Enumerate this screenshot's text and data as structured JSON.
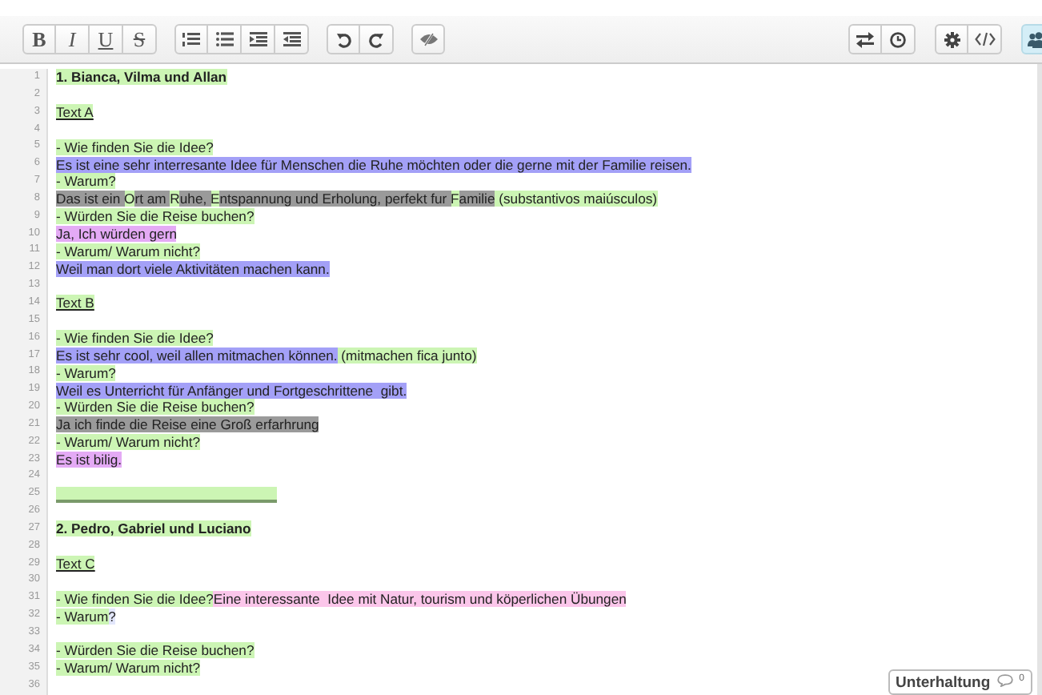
{
  "toolbar": {
    "left_groups": [
      [
        {
          "kind": "letter",
          "label": "B",
          "on": false
        },
        {
          "kind": "letter",
          "label": "I",
          "on": false
        },
        {
          "kind": "letter",
          "label": "U",
          "on": false
        },
        {
          "kind": "letter",
          "label": "S",
          "on": false
        }
      ],
      [
        {
          "kind": "ordered-list",
          "on": false
        },
        {
          "kind": "bullet-list",
          "on": false
        },
        {
          "kind": "indent",
          "on": false
        },
        {
          "kind": "outdent",
          "on": false
        }
      ],
      [
        {
          "kind": "undo",
          "on": false
        },
        {
          "kind": "redo",
          "on": false
        }
      ],
      [
        {
          "kind": "clear-authorship",
          "on": false
        }
      ]
    ],
    "right_groups": [
      [
        {
          "kind": "import-export",
          "on": false
        },
        {
          "kind": "history",
          "on": false
        }
      ],
      [
        {
          "kind": "settings",
          "on": false
        },
        {
          "kind": "embed",
          "on": false
        }
      ],
      [
        {
          "kind": "users",
          "on": true
        }
      ]
    ]
  },
  "lines": [
    {
      "number": "1",
      "kind": "heading",
      "segments": [
        {
          "text": "1. Bianca, Vilma und Allan",
          "color": "#ccf5b4"
        }
      ]
    },
    {
      "number": "2"
    },
    {
      "number": "3",
      "kind": "label",
      "segments": [
        {
          "text": "Text A",
          "color": "#ccf5b4"
        }
      ]
    },
    {
      "number": "4"
    },
    {
      "number": "5",
      "segments": [
        {
          "text": "- Wie finden Sie die Idee?",
          "color": "#ccf5b4"
        }
      ]
    },
    {
      "number": "6",
      "segments": [
        {
          "text": "Es ist eine sehr interresante Idee für Menschen die Ruhe möchten oder die gerne mit der Familie reisen.",
          "color": "#a3a0f7"
        }
      ]
    },
    {
      "number": "7",
      "segments": [
        {
          "text": "- Warum?",
          "color": "#ccf5b4"
        }
      ]
    },
    {
      "number": "8",
      "segments": [
        {
          "text": "Das ist ein ",
          "color": "#9a9a9a"
        },
        {
          "text": "O",
          "color": "#ccf5b4"
        },
        {
          "text": "rt am ",
          "color": "#9a9a9a"
        },
        {
          "text": "R",
          "color": "#ccf5b4"
        },
        {
          "text": "uhe, ",
          "color": "#9a9a9a"
        },
        {
          "text": "E",
          "color": "#ccf5b4"
        },
        {
          "text": "ntspannung und Erholung, perfekt fur ",
          "color": "#9a9a9a"
        },
        {
          "text": "F",
          "color": "#ccf5b4"
        },
        {
          "text": "amilie",
          "color": "#9a9a9a"
        },
        {
          "text": " (substantivos maiúsculos)",
          "color": "#ccf5b4"
        }
      ]
    },
    {
      "number": "9",
      "segments": [
        {
          "text": "- Würden Sie die Reise buchen?",
          "color": "#ccf5b4"
        }
      ]
    },
    {
      "number": "10",
      "segments": [
        {
          "text": "Ja, Ich würden gern",
          "color": "#e4aaf5"
        }
      ]
    },
    {
      "number": "11",
      "segments": [
        {
          "text": "- Warum/ Warum nicht?",
          "color": "#ccf5b4"
        }
      ]
    },
    {
      "number": "12",
      "segments": [
        {
          "text": "Weil man dort viele Aktivitäten machen kann.",
          "color": "#a3a0f7"
        }
      ]
    },
    {
      "number": "13"
    },
    {
      "number": "14",
      "kind": "label",
      "segments": [
        {
          "text": "Text B",
          "color": "#ccf5b4"
        }
      ]
    },
    {
      "number": "15"
    },
    {
      "number": "16",
      "segments": [
        {
          "text": "- Wie finden Sie die Idee?",
          "color": "#ccf5b4"
        }
      ]
    },
    {
      "number": "17",
      "segments": [
        {
          "text": "Es ist sehr cool, weil allen mitmachen können.",
          "color": "#a3a0f7"
        },
        {
          "text": " (mitmachen fica junto)",
          "color": "#ccf5b4"
        }
      ]
    },
    {
      "number": "18",
      "segments": [
        {
          "text": "- Warum?",
          "color": "#ccf5b4"
        }
      ]
    },
    {
      "number": "19",
      "segments": [
        {
          "text": "Weil es Unterricht für Anfänger und Fortgeschrittene  gibt.",
          "color": "#a3a0f7"
        }
      ]
    },
    {
      "number": "20",
      "segments": [
        {
          "text": "- Würden Sie die Reise buchen?",
          "color": "#ccf5b4"
        }
      ]
    },
    {
      "number": "21",
      "segments": [
        {
          "text": "Ja ich finde die Reise eine Groß erfarhrung",
          "color": "#9a9a9a"
        }
      ]
    },
    {
      "number": "22",
      "segments": [
        {
          "text": "- Warum/ Warum nicht?",
          "color": "#ccf5b4"
        }
      ]
    },
    {
      "number": "23",
      "segments": [
        {
          "text": "Es ist bilig.",
          "color": "#e4aaf5"
        }
      ]
    },
    {
      "number": "24"
    },
    {
      "number": "25",
      "rule": {
        "color": "#ccf5b4"
      }
    },
    {
      "number": "26"
    },
    {
      "number": "27",
      "kind": "heading",
      "segments": [
        {
          "text": "2. Pedro, Gabriel und Luciano",
          "color": "#ccf5b4"
        }
      ]
    },
    {
      "number": "28"
    },
    {
      "number": "29",
      "kind": "label",
      "segments": [
        {
          "text": "Text C",
          "color": "#ccf5b4"
        }
      ]
    },
    {
      "number": "30"
    },
    {
      "number": "31",
      "segments": [
        {
          "text": "- Wie finden Sie die Idee?",
          "color": "#ccf5b4"
        },
        {
          "text": "Eine interessante  Idee mit Natur, tourism und köperlichen Übungen",
          "color": "#fbc6ea"
        }
      ]
    },
    {
      "number": "32",
      "segments": [
        {
          "text": "- Warum",
          "color": "#ccf5b4"
        },
        {
          "text": "?",
          "color": "#e2e6fb"
        }
      ]
    },
    {
      "number": "33"
    },
    {
      "number": "34",
      "segments": [
        {
          "text": "- Würden Sie die Reise buchen?",
          "color": "#ccf5b4"
        }
      ]
    },
    {
      "number": "35",
      "segments": [
        {
          "text": "- Warum/ Warum nicht?",
          "color": "#ccf5b4"
        }
      ]
    },
    {
      "number": "36"
    }
  ],
  "chat": {
    "label": "Unterhaltung",
    "count": "0"
  }
}
